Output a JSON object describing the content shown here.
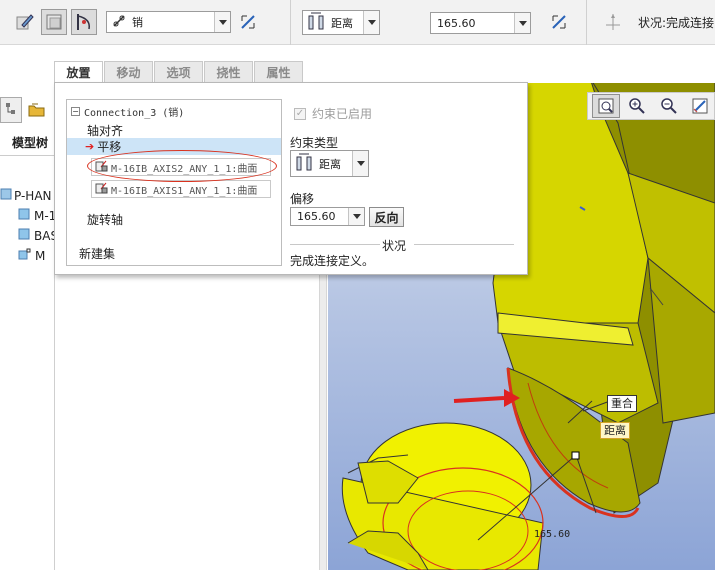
{
  "toolbar": {
    "constraint_combo_value": "销",
    "distance_type_label": "距离",
    "offset_value": "165.60",
    "status_text": "状况:完成连接"
  },
  "tabs": [
    {
      "label": "放置",
      "active": true
    },
    {
      "label": "移动",
      "active": false
    },
    {
      "label": "选项",
      "active": false
    },
    {
      "label": "挠性",
      "active": false
    },
    {
      "label": "属性",
      "active": false
    }
  ],
  "placement": {
    "connection_name": "Connection_3 (销)",
    "axis_alignment": "轴对齐",
    "translation": "平移",
    "ref_1": "M-16IB_AXIS2_ANY_1_1:曲面",
    "ref_2": "M-16IB_AXIS1_ANY_1_1:曲面",
    "rotation_axis": "旋转轴",
    "new_set": "新建集",
    "constraint_enabled": "约束已启用",
    "constraint_type_label": "约束类型",
    "constraint_type_value": "距离",
    "offset_label": "偏移",
    "offset_value": "165.60",
    "flip_button": "反向",
    "status_heading": "状况",
    "status_message": "完成连接定义。"
  },
  "model_tree": {
    "header": "模型树",
    "items": [
      "P-HAN",
      "M-1",
      "BAS",
      "M"
    ]
  },
  "viewport": {
    "callout_coincident": "重合",
    "callout_distance": "距离",
    "dimension_value": "165.60"
  },
  "colors": {
    "part_yellow": "#e8e800",
    "highlight_red": "#d9321f",
    "viewport_top": "#e3e9f3",
    "viewport_bottom": "#8ca4d6",
    "selection_blue": "#cde4f7"
  }
}
